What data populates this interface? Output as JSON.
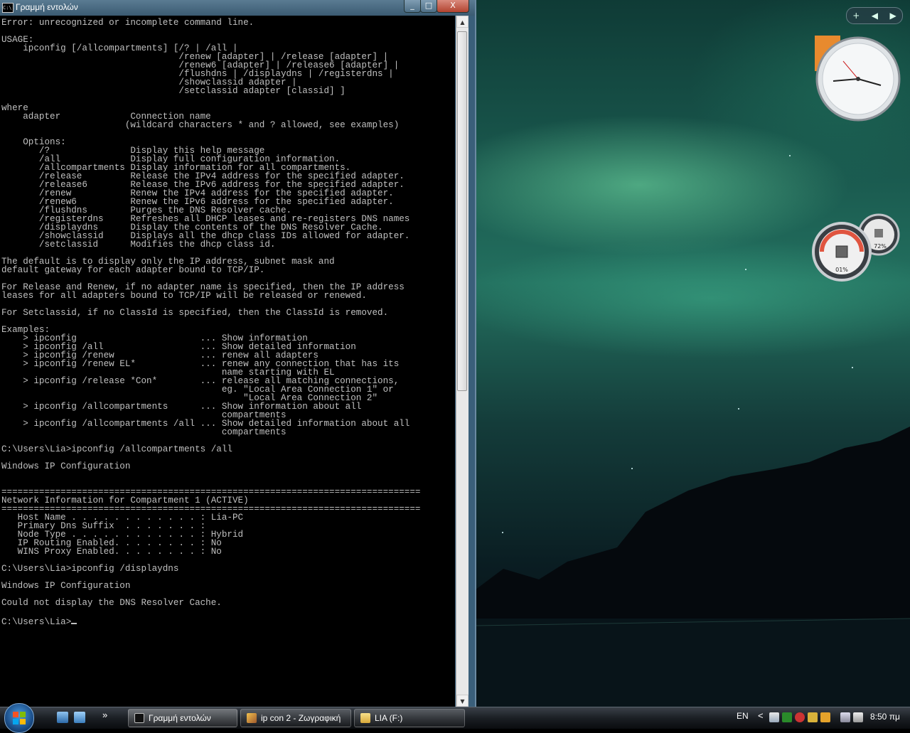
{
  "window": {
    "title": "Γραμμή εντολών",
    "icon_text": "C:\\.",
    "minimize_glyph": "_",
    "maximize_glyph": "□",
    "close_glyph": "X"
  },
  "console": {
    "lines": [
      "Error: unrecognized or incomplete command line.",
      "",
      "USAGE:",
      "    ipconfig [/allcompartments] [/? | /all |",
      "                                 /renew [adapter] | /release [adapter] |",
      "                                 /renew6 [adapter] | /release6 [adapter] |",
      "                                 /flushdns | /displaydns | /registerdns |",
      "                                 /showclassid adapter |",
      "                                 /setclassid adapter [classid] ]",
      "",
      "where",
      "    adapter             Connection name",
      "                       (wildcard characters * and ? allowed, see examples)",
      "",
      "    Options:",
      "       /?               Display this help message",
      "       /all             Display full configuration information.",
      "       /allcompartments Display information for all compartments.",
      "       /release         Release the IPv4 address for the specified adapter.",
      "       /release6        Release the IPv6 address for the specified adapter.",
      "       /renew           Renew the IPv4 address for the specified adapter.",
      "       /renew6          Renew the IPv6 address for the specified adapter.",
      "       /flushdns        Purges the DNS Resolver cache.",
      "       /registerdns     Refreshes all DHCP leases and re-registers DNS names",
      "       /displaydns      Display the contents of the DNS Resolver Cache.",
      "       /showclassid     Displays all the dhcp class IDs allowed for adapter.",
      "       /setclassid      Modifies the dhcp class id.",
      "",
      "The default is to display only the IP address, subnet mask and",
      "default gateway for each adapter bound to TCP/IP.",
      "",
      "For Release and Renew, if no adapter name is specified, then the IP address",
      "leases for all adapters bound to TCP/IP will be released or renewed.",
      "",
      "For Setclassid, if no ClassId is specified, then the ClassId is removed.",
      "",
      "Examples:",
      "    > ipconfig                       ... Show information",
      "    > ipconfig /all                  ... Show detailed information",
      "    > ipconfig /renew                ... renew all adapters",
      "    > ipconfig /renew EL*            ... renew any connection that has its",
      "                                         name starting with EL",
      "    > ipconfig /release *Con*        ... release all matching connections,",
      "                                         eg. \"Local Area Connection 1\" or",
      "                                             \"Local Area Connection 2\"",
      "    > ipconfig /allcompartments      ... Show information about all",
      "                                         compartments",
      "    > ipconfig /allcompartments /all ... Show detailed information about all",
      "                                         compartments",
      "",
      "C:\\Users\\Lia>ipconfig /allcompartments /all",
      "",
      "Windows IP Configuration",
      "",
      "",
      "==============================================================================",
      "Network Information for Compartment 1 (ACTIVE)",
      "==============================================================================",
      "   Host Name . . . . . . . . . . . . : Lia-PC",
      "   Primary Dns Suffix  . . . . . . . :",
      "   Node Type . . . . . . . . . . . . : Hybrid",
      "   IP Routing Enabled. . . . . . . . : No",
      "   WINS Proxy Enabled. . . . . . . . : No",
      "",
      "C:\\Users\\Lia>ipconfig /displaydns",
      "",
      "Windows IP Configuration",
      "",
      "Could not display the DNS Resolver Cache.",
      ""
    ],
    "prompt": "C:\\Users\\Lia>"
  },
  "scrollbar": {
    "up_glyph": "▲",
    "down_glyph": "▼"
  },
  "sidebar": {
    "add_glyph": "+",
    "prev_glyph": "◀",
    "next_glyph": "▶",
    "cpu_percent_label": "01%",
    "memory_percent_label": "72%"
  },
  "taskbar": {
    "more_glyph": "»",
    "tasks": [
      {
        "label": "Γραμμή εντολών",
        "icon": "command-prompt-icon"
      },
      {
        "label": "ip con 2 - Ζωγραφική",
        "icon": "paint-icon"
      },
      {
        "label": "LIA (F:)",
        "icon": "folder-icon"
      }
    ],
    "language": "EN",
    "tray_chevron": "<",
    "clock": "8:50 πμ"
  },
  "colors": {
    "console_text": "#c0c0c0",
    "console_bg": "#000000",
    "titlebar": "#3b5b72"
  }
}
